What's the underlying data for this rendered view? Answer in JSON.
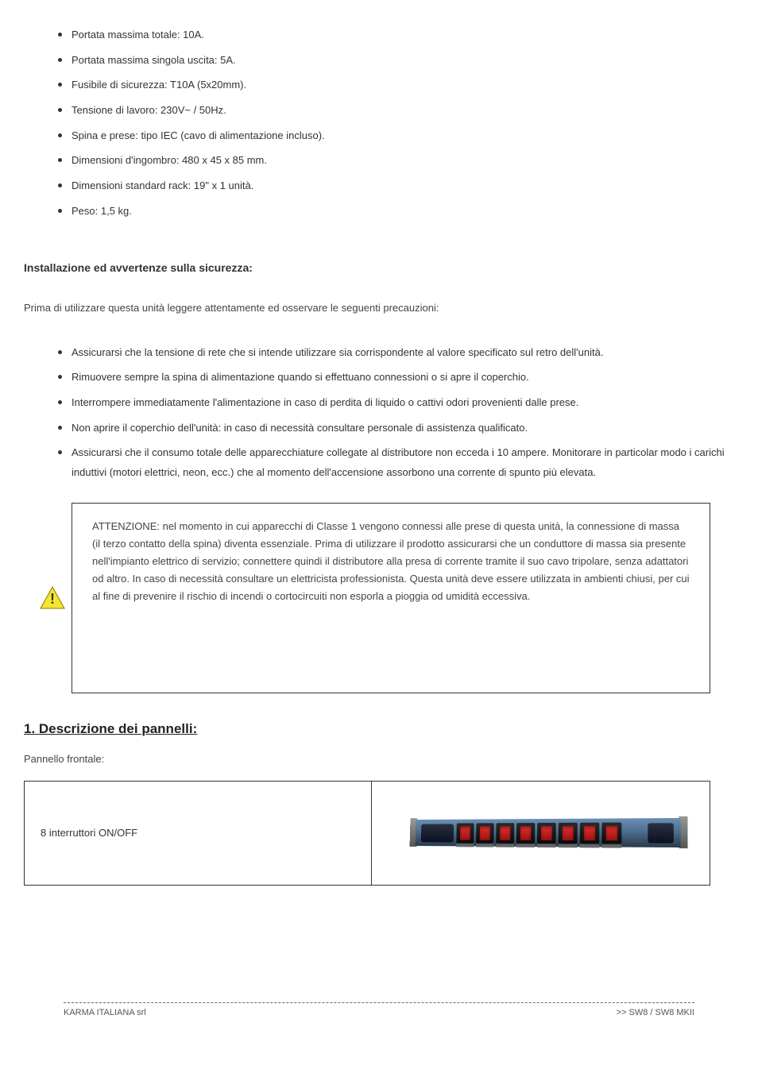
{
  "list1": {
    "items": [
      "Portata massima totale: 10A.",
      "Portata massima singola uscita: 5A.",
      "Fusibile di sicurezza: T10A (5x20mm).",
      "Tensione di lavoro: 230V~ / 50Hz.",
      "Spina e prese: tipo IEC (cavo di alimentazione incluso).",
      "Dimensioni d'ingombro: 480 x 45 x 85 mm.",
      "Dimensioni standard rack: 19\" x 1 unità.",
      "Peso: 1,5 kg."
    ]
  },
  "section1": {
    "heading": "Installazione ed avvertenze sulla sicurezza:",
    "desc": "Prima di utilizzare questa unità leggere attentamente ed osservare le seguenti precauzioni:"
  },
  "list2": {
    "items": [
      "Assicurarsi che la tensione di rete che si intende utilizzare sia corrispondente al valore specificato sul retro dell'unità.",
      "Rimuovere sempre la spina di alimentazione quando si effettuano connessioni o si apre il coperchio.",
      "Interrompere immediatamente l'alimentazione in caso di perdita di liquido o cattivi odori provenienti dalle prese.",
      "Non aprire il coperchio dell'unità: in caso di necessità consultare personale di assistenza qualificato.",
      "Assicurarsi che il consumo totale delle apparecchiature collegate al distributore non ecceda i 10 ampere. Monitorare in particolar modo i carichi induttivi (motori elettrici, neon, ecc.) che al momento dell'accensione assorbono una corrente di spunto più elevata."
    ]
  },
  "caution": {
    "text": "ATTENZIONE: nel momento in cui apparecchi di Classe 1 vengono connessi alle prese di questa unità, la connessione di massa (il terzo contatto della spina) diventa essenziale. Prima di utilizzare il prodotto assicurarsi che un conduttore di massa sia presente nell'impianto elettrico di servizio; connettere quindi il distributore alla presa di corrente tramite il suo cavo tripolare, senza adattatori od altro. In caso di necessità consultare un elettricista professionista. Questa unità deve essere utilizzata in ambienti chiusi, per cui al fine di prevenire il rischio di incendi o cortocircuiti non esporla a pioggia od umidità eccessiva."
  },
  "section2": {
    "heading": "1. Descrizione dei pannelli:",
    "desc": "Pannello frontale:"
  },
  "table": {
    "left_text": "8 interruttori ON/OFF",
    "switch_count": 8
  },
  "footer": {
    "left": "KARMA ITALIANA srl",
    "right": ">> SW8 / SW8 MKII"
  }
}
